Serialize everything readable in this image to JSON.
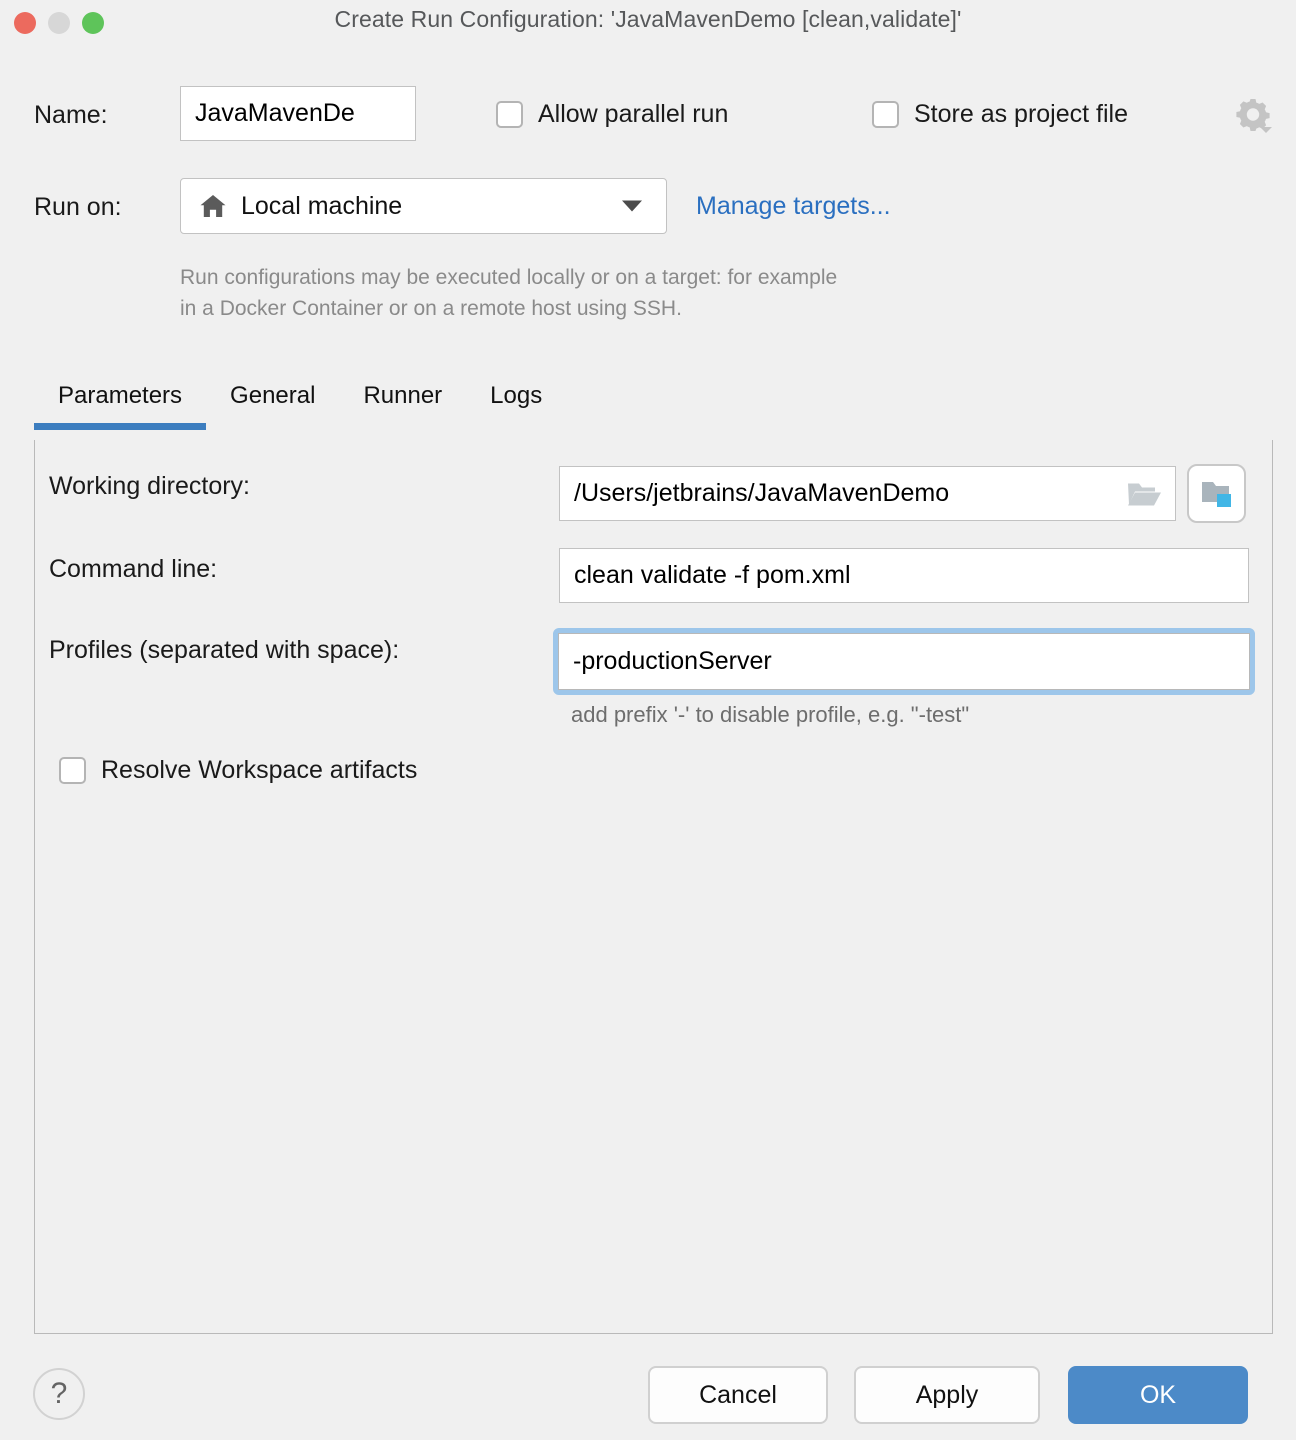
{
  "window": {
    "title": "Create Run Configuration: 'JavaMavenDemo [clean,validate]'",
    "traffic_lights": {
      "close": "close-button",
      "minimize": "minimize-button",
      "zoom": "zoom-button"
    }
  },
  "form": {
    "name_label": "Name:",
    "name_value": "JavaMavenDe",
    "allow_parallel_run_label": "Allow parallel run",
    "allow_parallel_run_checked": false,
    "store_as_project_file_label": "Store as project file",
    "store_as_project_file_checked": false,
    "gear_icon": "gear-icon",
    "run_on_label": "Run on:",
    "run_on_value": "Local machine",
    "run_on_icon": "home-icon",
    "manage_targets_link": "Manage targets...",
    "hint_line1": "Run configurations may be executed locally or on a target: for example",
    "hint_line2": "in a Docker Container or on a remote host using SSH."
  },
  "tabs": [
    {
      "label": "Parameters",
      "active": true
    },
    {
      "label": "General",
      "active": false
    },
    {
      "label": "Runner",
      "active": false
    },
    {
      "label": "Logs",
      "active": false
    }
  ],
  "parameters": {
    "working_directory_label": "Working directory:",
    "working_directory_value": "/Users/jetbrains/JavaMavenDemo",
    "working_directory_browse_icon": "folder-icon",
    "working_directory_macro_icon": "insert-macro-folder-icon",
    "command_line_label": "Command line:",
    "command_line_value": "clean validate -f pom.xml",
    "profiles_label": "Profiles (separated with space):",
    "profiles_value": "-productionServer",
    "profiles_hint": "add prefix '-' to disable profile, e.g. \"-test\"",
    "resolve_workspace_artifacts_label": "Resolve Workspace artifacts",
    "resolve_workspace_artifacts_checked": false
  },
  "footer": {
    "help_label": "?",
    "cancel_label": "Cancel",
    "apply_label": "Apply",
    "ok_label": "OK"
  },
  "colors": {
    "accent_blue": "#3c7dbf",
    "ok_button_blue": "#4c8ac8",
    "link_blue": "#2a6fc0",
    "focus_ring": "#9dc6ea",
    "background": "#f0f0f0",
    "close_light": "#ec6a5e",
    "minimize_light": "#d7d7d7",
    "zoom_light": "#5ec45a"
  }
}
